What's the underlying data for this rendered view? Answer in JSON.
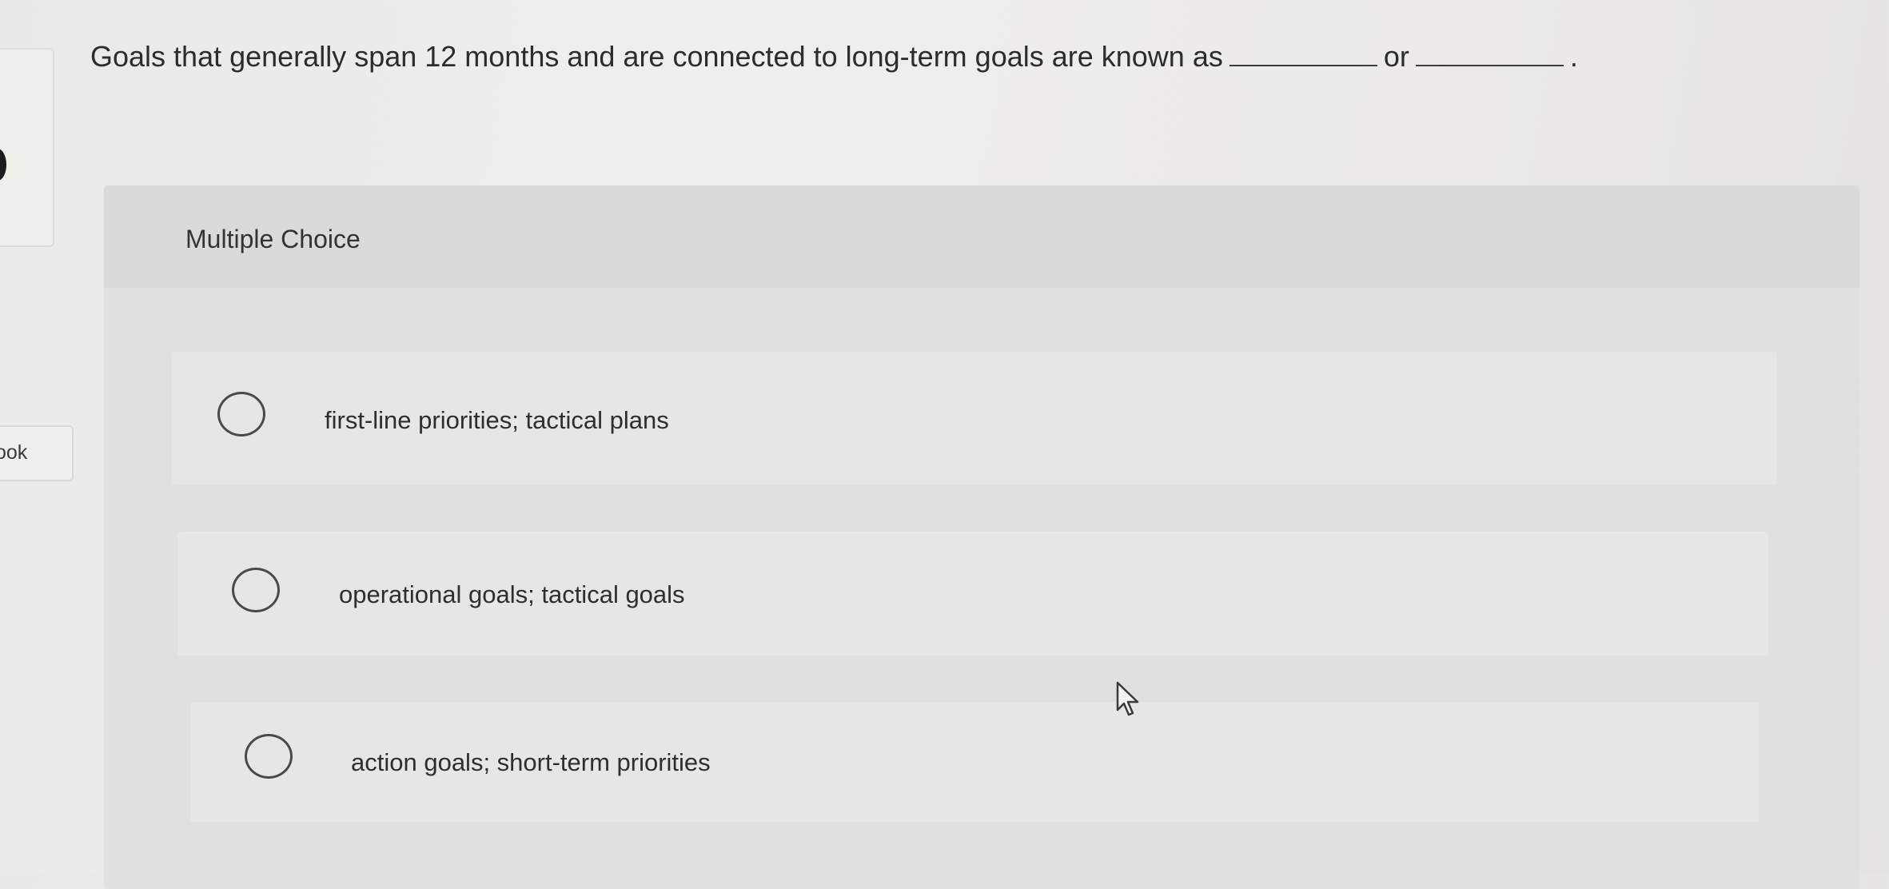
{
  "sidebar": {
    "tab_label": "ook"
  },
  "question": {
    "text_before": "Goals that generally span 12 months and are connected to long-term goals are known as",
    "text_middle": "or",
    "text_end": "."
  },
  "answer_panel": {
    "header": "Multiple Choice",
    "choices": [
      {
        "label": "first-line priorities; tactical plans",
        "selected": false
      },
      {
        "label": "operational goals; tactical goals",
        "selected": false
      },
      {
        "label": "action goals; short-term priorities",
        "selected": false
      }
    ]
  },
  "icons": {
    "radio": "radio-button-icon",
    "cursor": "mouse-pointer-icon"
  }
}
